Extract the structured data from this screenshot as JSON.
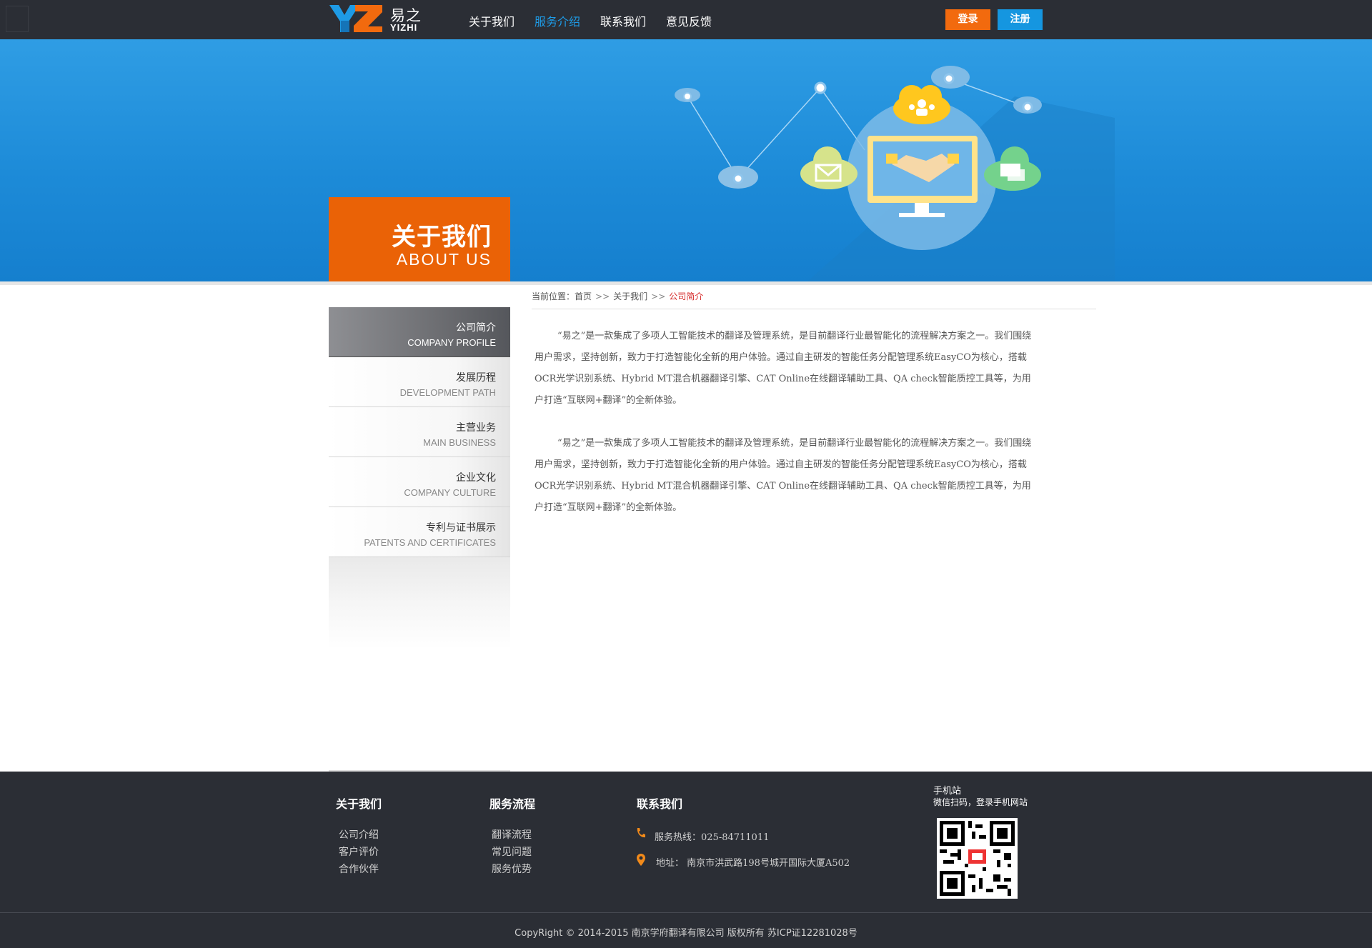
{
  "header": {
    "logo_cn": "易之",
    "logo_en": "YIZHI",
    "nav": [
      {
        "label": "关于我们"
      },
      {
        "label": "服务介绍"
      },
      {
        "label": "联系我们"
      },
      {
        "label": "意见反馈"
      }
    ],
    "active_nav": "服务介绍",
    "login_label": "登录",
    "register_label": "注册",
    "colors": {
      "bar": "#2b2e35",
      "active": "#1e9be6",
      "login": "#f26a0e",
      "register": "#1596e0"
    }
  },
  "banner": {
    "title_cn": "关于我们",
    "title_en": "ABOUT US",
    "accent": "#ea6206",
    "icons": [
      "people-cloud-icon",
      "mail-cloud-icon",
      "chat-cloud-icon",
      "handshake-monitor-icon",
      "network-node-icon"
    ]
  },
  "sidebar": {
    "items": [
      {
        "cn": "公司简介",
        "en": "COMPANY PROFILE"
      },
      {
        "cn": "发展历程",
        "en": "DEVELOPMENT PATH"
      },
      {
        "cn": "主营业务",
        "en": "MAIN BUSINESS"
      },
      {
        "cn": "企业文化",
        "en": "COMPANY CULTURE"
      },
      {
        "cn": "专利与证书展示",
        "en": "PATENTS AND CERTIFICATES"
      }
    ],
    "active": "公司简介"
  },
  "breadcrumb": {
    "prefix": "当前位置：",
    "home": "首页",
    "sep": ">>",
    "parent": "关于我们",
    "current": "公司简介"
  },
  "content": {
    "paragraphs": [
      "“易之”是一款集成了多项人工智能技术的翻译及管理系统，是目前翻译行业最智能化的流程解决方案之一。我们围绕用户需求，坚持创新，致力于打造智能化全新的用户体验。通过自主研发的智能任务分配管理系统EasyCO为核心，搭载OCR光学识别系统、Hybrid MT混合机器翻译引擎、CAT Online在线翻译辅助工具、QA check智能质控工具等，为用户打造“互联网+翻译”的全新体验。",
      "“易之”是一款集成了多项人工智能技术的翻译及管理系统，是目前翻译行业最智能化的流程解决方案之一。我们围绕用户需求，坚持创新，致力于打造智能化全新的用户体验。通过自主研发的智能任务分配管理系统EasyCO为核心，搭载OCR光学识别系统、Hybrid MT混合机器翻译引擎、CAT Online在线翻译辅助工具、QA check智能质控工具等，为用户打造“互联网+翻译”的全新体验。"
    ]
  },
  "footer": {
    "about": {
      "title": "关于我们",
      "links": [
        "公司介绍",
        "客户评价",
        "合作伙伴"
      ]
    },
    "service": {
      "title": "服务流程",
      "links": [
        "翻译流程",
        "常见问题",
        "服务优势"
      ]
    },
    "contact": {
      "title": "联系我们",
      "hotline": "服务热线：025-84711011",
      "address": "地址：  南京市洪武路198号城开国际大厦A502"
    },
    "mobile": {
      "title": "手机站",
      "subtitle": "微信扫码，登录手机网站"
    },
    "copyright": "CopyRight © 2014-2015 南京学府翻译有限公司 版权所有 苏ICP证12281028号"
  }
}
